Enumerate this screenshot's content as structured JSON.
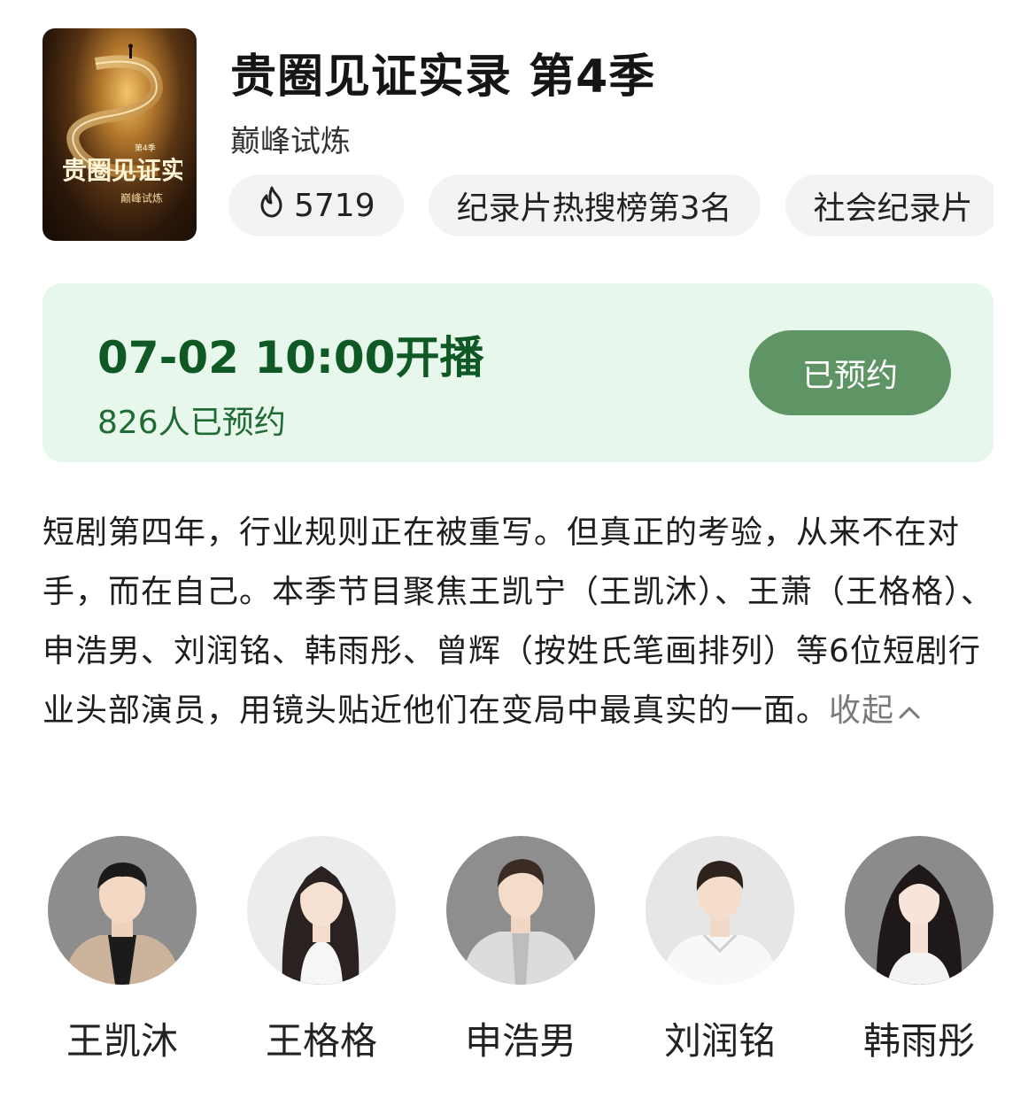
{
  "show": {
    "title": "贵圈见证实录 第4季",
    "subtitle": "巅峰试炼",
    "poster_text": "贵圈见证实录",
    "poster_badge": "第4季",
    "poster_sub": "巅峰试炼"
  },
  "tags": [
    {
      "icon": "flame-icon",
      "label": "5719"
    },
    {
      "label": "纪录片热搜榜第3名"
    },
    {
      "label": "社会纪录片"
    }
  ],
  "reservation": {
    "time_label": "07-02 10:00开播",
    "count_label": "826人已预约",
    "button_label": "已预约"
  },
  "description": {
    "text": "短剧第四年，行业规则正在被重写。但真正的考验，从来不在对手，而在自己。本季节目聚焦王凯宁（王凯沐）、王萧（王格格）、申浩男、刘润铭、韩雨彤、曾辉（按姓氏笔画排列）等6位短剧行业头部演员，用镜头贴近他们在变局中最真实的一面。",
    "toggle_label": "收起"
  },
  "cast": [
    {
      "name": "王凯沐"
    },
    {
      "name": "王格格"
    },
    {
      "name": "申浩男"
    },
    {
      "name": "刘润铭"
    },
    {
      "name": "韩雨彤"
    }
  ],
  "colors": {
    "reserve_bg": "#e8f7ec",
    "reserve_text": "#0f5a24",
    "reserve_button": "#5f9465",
    "tag_bg": "#f3f3f3"
  }
}
